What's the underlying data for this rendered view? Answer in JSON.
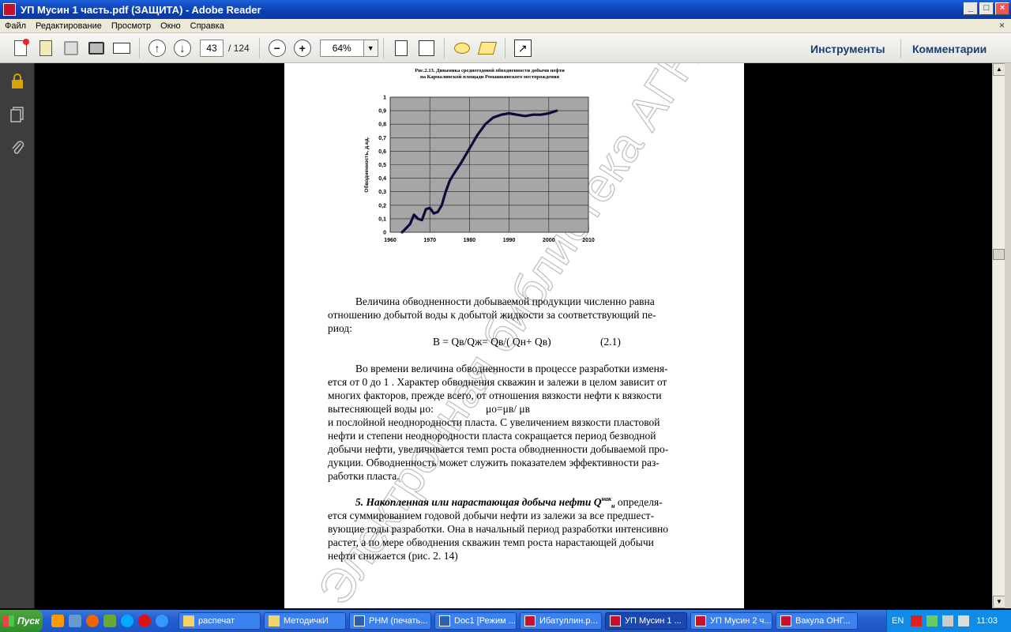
{
  "window": {
    "title": "УП Мусин 1 часть.pdf (ЗАЩИТА) - Adobe Reader"
  },
  "menu": [
    "Файл",
    "Редактирование",
    "Просмотр",
    "Окно",
    "Справка"
  ],
  "toolbar": {
    "page_current": "43",
    "page_total": "/ 124",
    "zoom": "64%",
    "tools_label": "Инструменты",
    "comments_label": "Комментарии"
  },
  "document": {
    "figure_caption_1": "Рис.2.13. Динамика среднегодовой обводненности добычи нефти",
    "figure_caption_2": "на Кармалинской площади Ромашкинского месторождения",
    "watermark": "Электронная библиотека АГНИ",
    "para1": "Величина обводненности добываемой продукции численно равна отношению добытой воды к добытой жидкости за  соответствующий период:",
    "formula": "B = Qв/Qж= Qв/( Qн+ Qв)",
    "formula_num": "(2.1)",
    "para2a": "Во времени величина обводненности в процессе разработки  изменяется от 0 до 1 . Характер обводнения скважин и залежи в целом зависит от многих факторов, прежде всего, от отношения вязкости нефти к вязкости вытесняющей воды μо:",
    "para2_formula": "μо=μв/ μв",
    "para2b": "и послойной неоднородности пласта. С увеличением вязкости пластовой нефти и степени неоднородности пласта сокращается период безводной добычи нефти, увеличивается темп роста обводненности добываемой продукции. Обводненность может служить показателем эффективности разработки пласта.",
    "para3_title": "5. Накопленная или нарастающая добыча нефти Q",
    "para3_sup": "нак",
    "para3_sub": "н",
    "para3_text": " определяется суммированием годовой добычи нефти из залежи за все предшествующие годы разработки. Она в начальный период разработки интенсивно растет, а по мере обводнения скважин темп роста нарастающей добычи нефти снижается (рис. 2. 14)"
  },
  "chart_data": {
    "type": "line",
    "ylabel": "Обводненность, д.ед.",
    "xlabel": "",
    "xlim": [
      1960,
      2010
    ],
    "ylim": [
      0,
      1
    ],
    "x_ticks": [
      "1960",
      "1970",
      "1980",
      "1990",
      "2000",
      "2010"
    ],
    "y_ticks": [
      "0",
      "0,1",
      "0,2",
      "0,3",
      "0,4",
      "0,5",
      "0,6",
      "0,7",
      "0,8",
      "0,9",
      "1"
    ],
    "grid": true,
    "series": [
      {
        "x": [
          1963,
          1964,
          1965,
          1966,
          1967,
          1968,
          1969,
          1970,
          1971,
          1972,
          1973,
          1974,
          1975,
          1976,
          1978,
          1980,
          1982,
          1984,
          1986,
          1988,
          1990,
          1992,
          1994,
          1996,
          1998,
          2000,
          2002
        ],
        "y": [
          0.0,
          0.03,
          0.06,
          0.13,
          0.1,
          0.09,
          0.17,
          0.18,
          0.14,
          0.15,
          0.2,
          0.3,
          0.38,
          0.43,
          0.52,
          0.62,
          0.72,
          0.8,
          0.85,
          0.87,
          0.88,
          0.87,
          0.86,
          0.87,
          0.87,
          0.88,
          0.9
        ]
      }
    ]
  },
  "taskbar": {
    "start": "Пуск",
    "tasks": [
      "распечат",
      "МетодичкИ",
      "РНМ (печать...",
      "Doc1 [Режим ...",
      "Ибатуллин.р...",
      "УП Мусин 1 ...",
      "УП Мусин 2 ч...",
      "Вакула ОНГ..."
    ],
    "lang": "EN",
    "clock": "11:03"
  }
}
